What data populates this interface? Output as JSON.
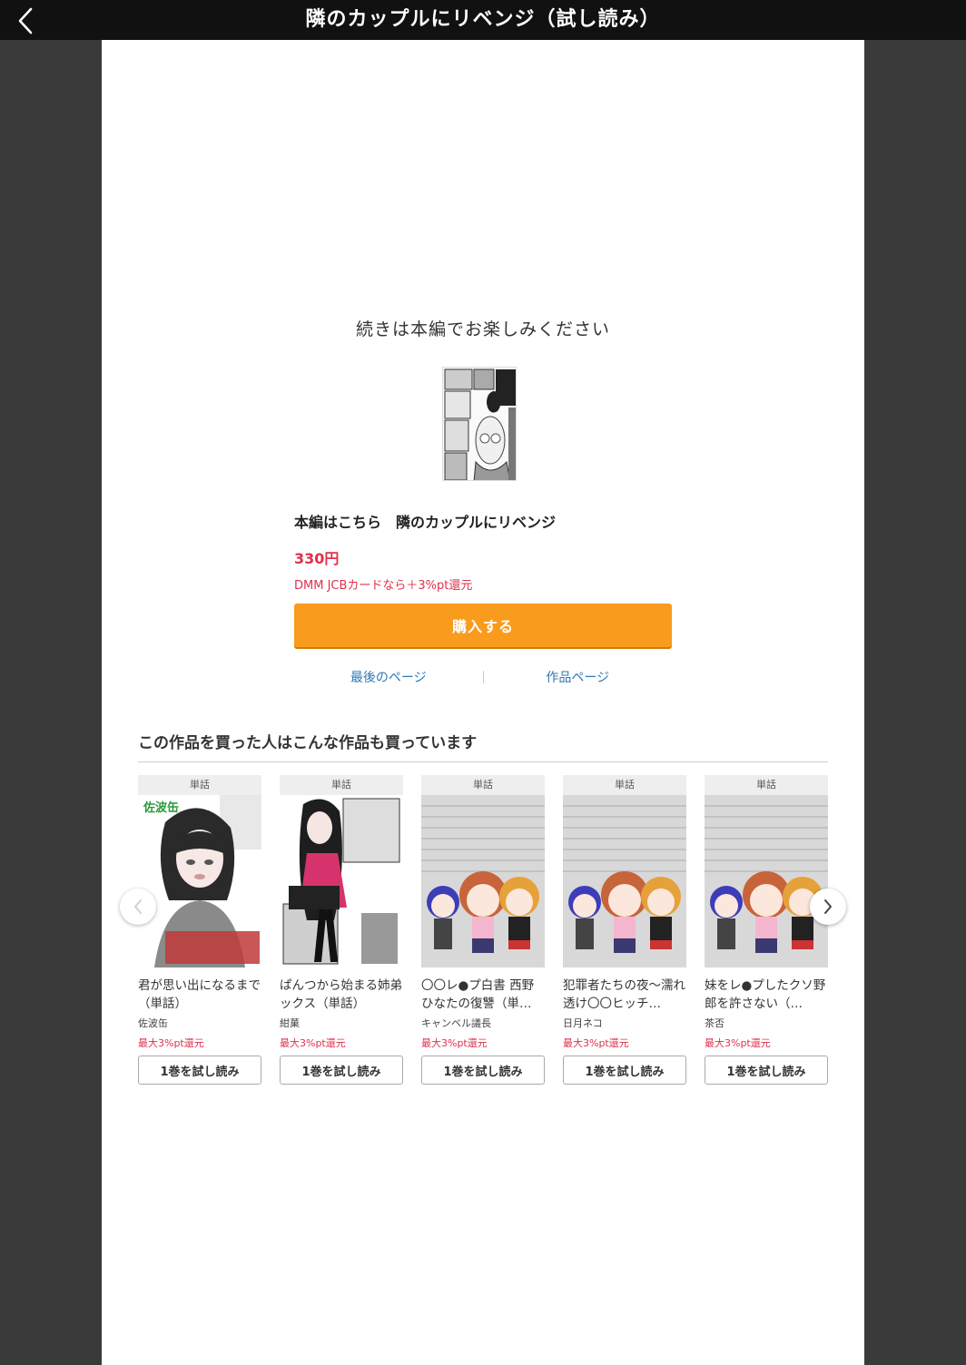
{
  "header": {
    "title": "隣のカップルにリベンジ（試し読み）"
  },
  "continue": {
    "message": "続きは本編でお楽しみください"
  },
  "purchase": {
    "title": "本編はこちら　隣のカップルにリベンジ",
    "price": "330円",
    "jcb_note": "DMM JCBカードなら＋3%pt還元",
    "buy_label": "購入する"
  },
  "links": {
    "last_page": "最後のページ",
    "work_page": "作品ページ"
  },
  "recommendations": {
    "heading": "この作品を買った人はこんな作品も買っています",
    "items": [
      {
        "tag": "単話",
        "cover_text": "佐波缶",
        "title": "君が思い出になるまで（単話）",
        "author": "佐波缶",
        "points": "最大3%pt還元",
        "button": "1巻を試し読み"
      },
      {
        "tag": "単話",
        "title": "ぱんつから始まる姉弟ックス（単話）",
        "author": "紺菓",
        "points": "最大3%pt還元",
        "button": "1巻を試し読み"
      },
      {
        "tag": "単話",
        "title": "〇〇レ●プ白書 西野ひなたの復讐（単…",
        "author": "キャンベル議長",
        "points": "最大3%pt還元",
        "button": "1巻を試し読み"
      },
      {
        "tag": "単話",
        "title": "犯罪者たちの夜〜濡れ透け〇〇ヒッチ…",
        "author": "日月ネコ",
        "points": "最大3%pt還元",
        "button": "1巻を試し読み"
      },
      {
        "tag": "単話",
        "title": "妹をレ●プしたクソ野郎を許さない（…",
        "author": "茶否",
        "points": "最大3%pt還元",
        "button": "1巻を試し読み"
      }
    ]
  },
  "colors": {
    "accent_orange": "#f99b1c",
    "price_red": "#e0314b",
    "link_blue": "#2f78b3"
  },
  "icons": {
    "back": "chevron-left-icon",
    "prev": "chevron-left-icon",
    "next": "chevron-right-icon"
  }
}
